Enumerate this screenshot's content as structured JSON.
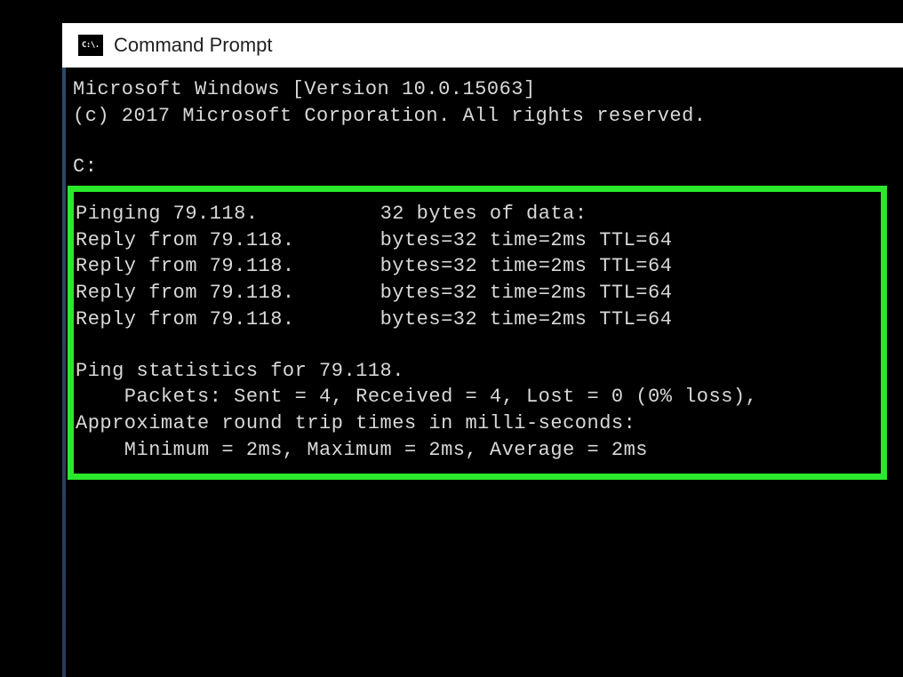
{
  "titlebar": {
    "icon_text": "C:\\.",
    "title": "Command Prompt"
  },
  "header": {
    "version_line": "Microsoft Windows [Version 10.0.15063]",
    "copyright_line": "(c) 2017 Microsoft Corporation. All rights reserved.",
    "prompt": "C:"
  },
  "ping": {
    "pinging_left": "Pinging 79.118.",
    "pinging_right": "32 bytes of data:",
    "reply_left": "Reply from 79.118.",
    "reply_right": "bytes=32 time=2ms TTL=64",
    "stats_header": "Ping statistics for 79.118.",
    "packets": "    Packets: Sent = 4, Received = 4, Lost = 0 (0% loss),",
    "rtt_header": "Approximate round trip times in milli-seconds:",
    "rtt_values": "    Minimum = 2ms, Maximum = 2ms, Average = 2ms"
  }
}
